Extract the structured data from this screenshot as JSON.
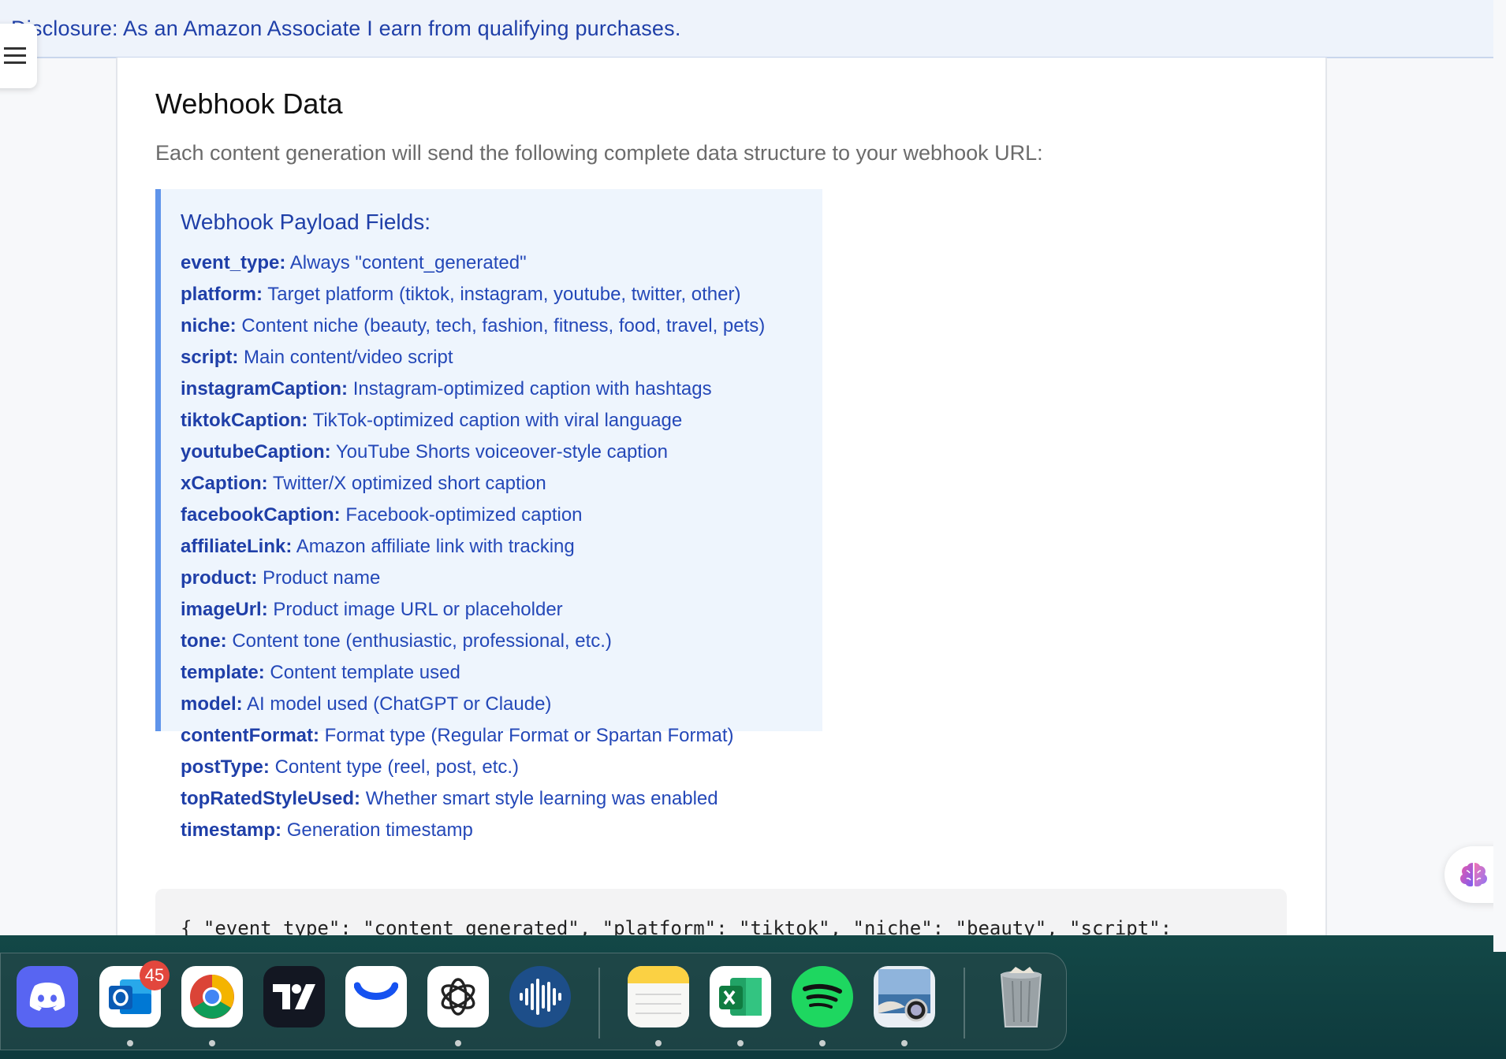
{
  "banner": {
    "disclosure": "Disclosure: As an Amazon Associate I earn from qualifying purchases."
  },
  "icons": {
    "menu": "hamburger-menu-icon",
    "assistant": "brain-icon"
  },
  "section": {
    "title": "Webhook Data",
    "description": "Each content generation will send the following complete data structure to your webhook URL:"
  },
  "payload": {
    "title": "Webhook Payload Fields:",
    "fields": [
      {
        "key": "event_type:",
        "desc": "Always \"content_generated\""
      },
      {
        "key": "platform:",
        "desc": "Target platform (tiktok, instagram, youtube, twitter, other)"
      },
      {
        "key": "niche:",
        "desc": "Content niche (beauty, tech, fashion, fitness, food, travel, pets)"
      },
      {
        "key": "script:",
        "desc": "Main content/video script"
      },
      {
        "key": "instagramCaption:",
        "desc": "Instagram-optimized caption with hashtags"
      },
      {
        "key": "tiktokCaption:",
        "desc": "TikTok-optimized caption with viral language"
      },
      {
        "key": "youtubeCaption:",
        "desc": "YouTube Shorts voiceover-style caption"
      },
      {
        "key": "xCaption:",
        "desc": "Twitter/X optimized short caption"
      },
      {
        "key": "facebookCaption:",
        "desc": "Facebook-optimized caption"
      },
      {
        "key": "affiliateLink:",
        "desc": "Amazon affiliate link with tracking"
      },
      {
        "key": "product:",
        "desc": "Product name"
      },
      {
        "key": "imageUrl:",
        "desc": "Product image URL or placeholder"
      },
      {
        "key": "tone:",
        "desc": "Content tone (enthusiastic, professional, etc.)"
      },
      {
        "key": "template:",
        "desc": "Content template used"
      },
      {
        "key": "model:",
        "desc": "AI model used (ChatGPT or Claude)"
      },
      {
        "key": "contentFormat:",
        "desc": "Format type (Regular Format or Spartan Format)"
      },
      {
        "key": "postType:",
        "desc": "Content type (reel, post, etc.)"
      },
      {
        "key": "topRatedStyleUsed:",
        "desc": "Whether smart style learning was enabled"
      },
      {
        "key": "timestamp:",
        "desc": "Generation timestamp"
      }
    ]
  },
  "code": {
    "line1": "{ \"event_type\": \"content_generated\", \"platform\": \"tiktok\", \"niche\": \"beauty\", \"script\":"
  },
  "dock": {
    "apps": [
      {
        "name": "Discord",
        "icon": "discord-icon",
        "running": false
      },
      {
        "name": "Outlook",
        "icon": "outlook-icon",
        "running": true,
        "badge": "45"
      },
      {
        "name": "Chrome",
        "icon": "chrome-icon",
        "running": true
      },
      {
        "name": "TradingView",
        "icon": "tradingview-icon",
        "running": false
      },
      {
        "name": "Coinbase",
        "icon": "coinbase-icon",
        "running": false
      },
      {
        "name": "ChatGPT",
        "icon": "chatgpt-icon",
        "running": true
      },
      {
        "name": "Voice Memos",
        "icon": "waveform-icon",
        "running": false
      },
      {
        "name": "Notes",
        "icon": "notes-icon",
        "running": true
      },
      {
        "name": "Excel",
        "icon": "excel-icon",
        "running": true
      },
      {
        "name": "Spotify",
        "icon": "spotify-icon",
        "running": true
      },
      {
        "name": "Preview",
        "icon": "preview-icon",
        "running": true
      },
      {
        "name": "Trash",
        "icon": "trash-icon",
        "running": false
      }
    ]
  },
  "colors": {
    "link_blue": "#1f3fa8",
    "accent_border": "#5f94ea",
    "payload_bg": "#eef5fd",
    "badge_red": "#e2473d"
  }
}
